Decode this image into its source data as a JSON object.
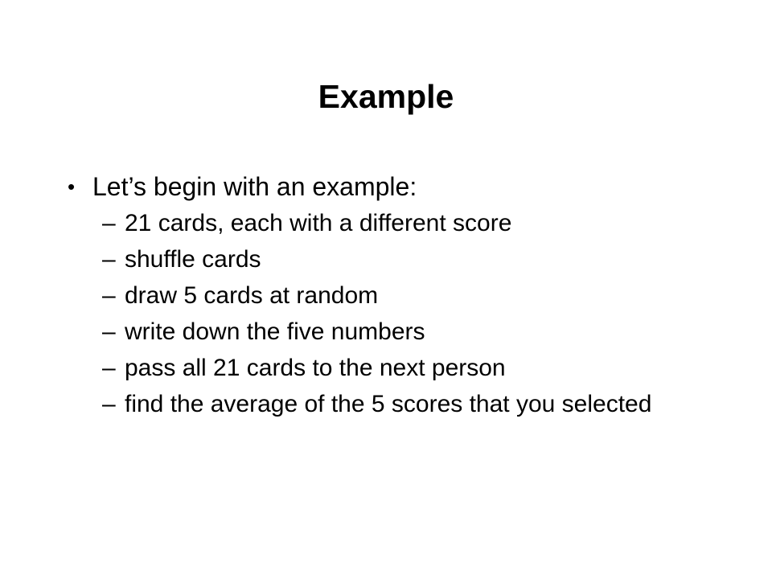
{
  "slide": {
    "title": "Example",
    "background_color": "#ffffff",
    "text_color": "#000000",
    "bullets": [
      {
        "level": 1,
        "marker": "•",
        "text": "Let’s begin with an example:"
      },
      {
        "level": 2,
        "marker": "–",
        "text": "21 cards, each with a different score"
      },
      {
        "level": 2,
        "marker": "–",
        "text": "shuffle cards"
      },
      {
        "level": 2,
        "marker": "–",
        "text": "draw 5 cards at random"
      },
      {
        "level": 2,
        "marker": "–",
        "text": "write down the five numbers"
      },
      {
        "level": 2,
        "marker": "–",
        "text": "pass all 21 cards to the next person"
      },
      {
        "level": 2,
        "marker": "–",
        "text": "find the average of the 5 scores that you selected"
      }
    ]
  }
}
